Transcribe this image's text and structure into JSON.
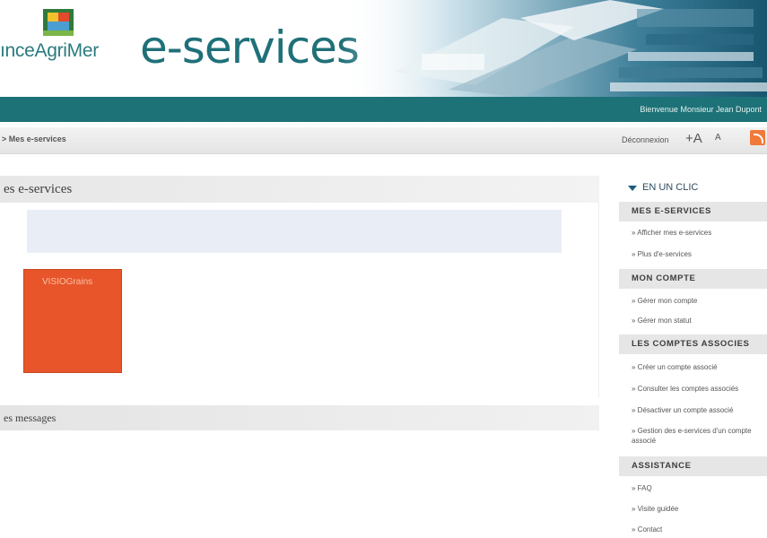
{
  "header": {
    "logo_text": "ınceAgriMer",
    "title": "e-services",
    "welcome": "Bienvenue Monsieur Jean Dupont"
  },
  "breadcrumb": "> Mes e-services",
  "toolbar": {
    "logout": "Déconnexion",
    "font_bigger": "+A",
    "font_smaller": "A"
  },
  "main": {
    "section_title": "es e-services",
    "tile_label": "VISIOGrains",
    "messages_title": "es messages"
  },
  "sidebar": {
    "title": "EN UN CLIC",
    "groups": [
      {
        "label": "MES E-SERVICES",
        "links": [
          "» Afficher mes e-services",
          "» Plus d'e-services"
        ]
      },
      {
        "label": "MON COMPTE",
        "links": [
          "» Gérer mon compte",
          "» Gérer mon statut"
        ]
      },
      {
        "label": "LES COMPTES ASSOCIES",
        "links": [
          "» Créer un compte associé",
          "» Consulter les comptes associés",
          "» Désactiver un compte associé",
          "» Gestion des e-services d'un compte associé"
        ]
      },
      {
        "label": "ASSISTANCE",
        "links": [
          "» FAQ",
          "» Visite guidée",
          "» Contact"
        ]
      }
    ]
  },
  "colors": {
    "brand_teal": "#1d7277",
    "tile_orange": "#e8552a",
    "info_box": "#e9eef6"
  }
}
